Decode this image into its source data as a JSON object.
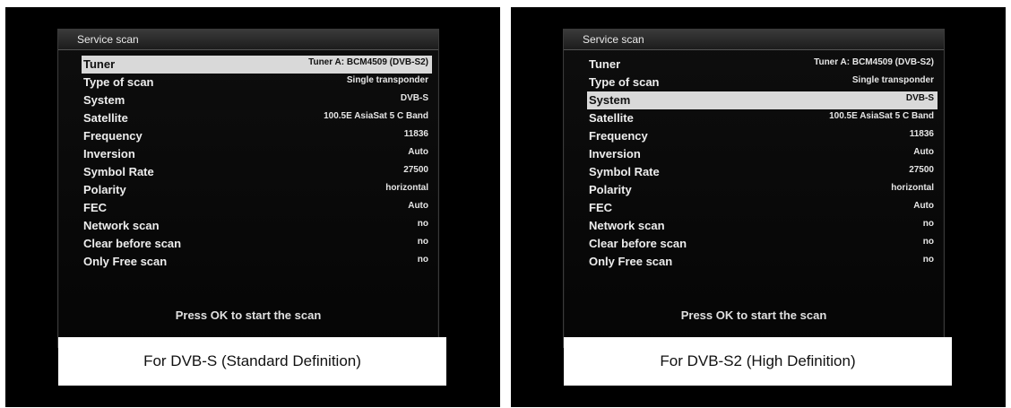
{
  "screens": [
    {
      "window_title": "Service scan",
      "selected_index": 0,
      "rows": [
        {
          "label": "Tuner",
          "value": "Tuner A: BCM4509 (DVB-S2)"
        },
        {
          "label": "Type of scan",
          "value": "Single transponder"
        },
        {
          "label": "System",
          "value": "DVB-S"
        },
        {
          "label": "Satellite",
          "value": "100.5E AsiaSat 5 C Band"
        },
        {
          "label": "Frequency",
          "value": "11836"
        },
        {
          "label": "Inversion",
          "value": "Auto"
        },
        {
          "label": "Symbol Rate",
          "value": "27500"
        },
        {
          "label": "Polarity",
          "value": "horizontal"
        },
        {
          "label": "FEC",
          "value": "Auto"
        },
        {
          "label": "Network scan",
          "value": "no"
        },
        {
          "label": "Clear before scan",
          "value": "no"
        },
        {
          "label": "Only Free scan",
          "value": "no"
        }
      ],
      "hint": "Press OK to start the scan",
      "caption": "For DVB-S (Standard Definition)"
    },
    {
      "window_title": "Service scan",
      "selected_index": 2,
      "rows": [
        {
          "label": "Tuner",
          "value": "Tuner A: BCM4509 (DVB-S2)"
        },
        {
          "label": "Type of scan",
          "value": "Single transponder"
        },
        {
          "label": "System",
          "value": "DVB-S"
        },
        {
          "label": "Satellite",
          "value": "100.5E AsiaSat 5 C Band"
        },
        {
          "label": "Frequency",
          "value": "11836"
        },
        {
          "label": "Inversion",
          "value": "Auto"
        },
        {
          "label": "Symbol Rate",
          "value": "27500"
        },
        {
          "label": "Polarity",
          "value": "horizontal"
        },
        {
          "label": "FEC",
          "value": "Auto"
        },
        {
          "label": "Network scan",
          "value": "no"
        },
        {
          "label": "Clear before scan",
          "value": "no"
        },
        {
          "label": "Only Free scan",
          "value": "no"
        }
      ],
      "hint": "Press OK to start the scan",
      "caption": "For DVB-S2 (High Definition)"
    }
  ]
}
